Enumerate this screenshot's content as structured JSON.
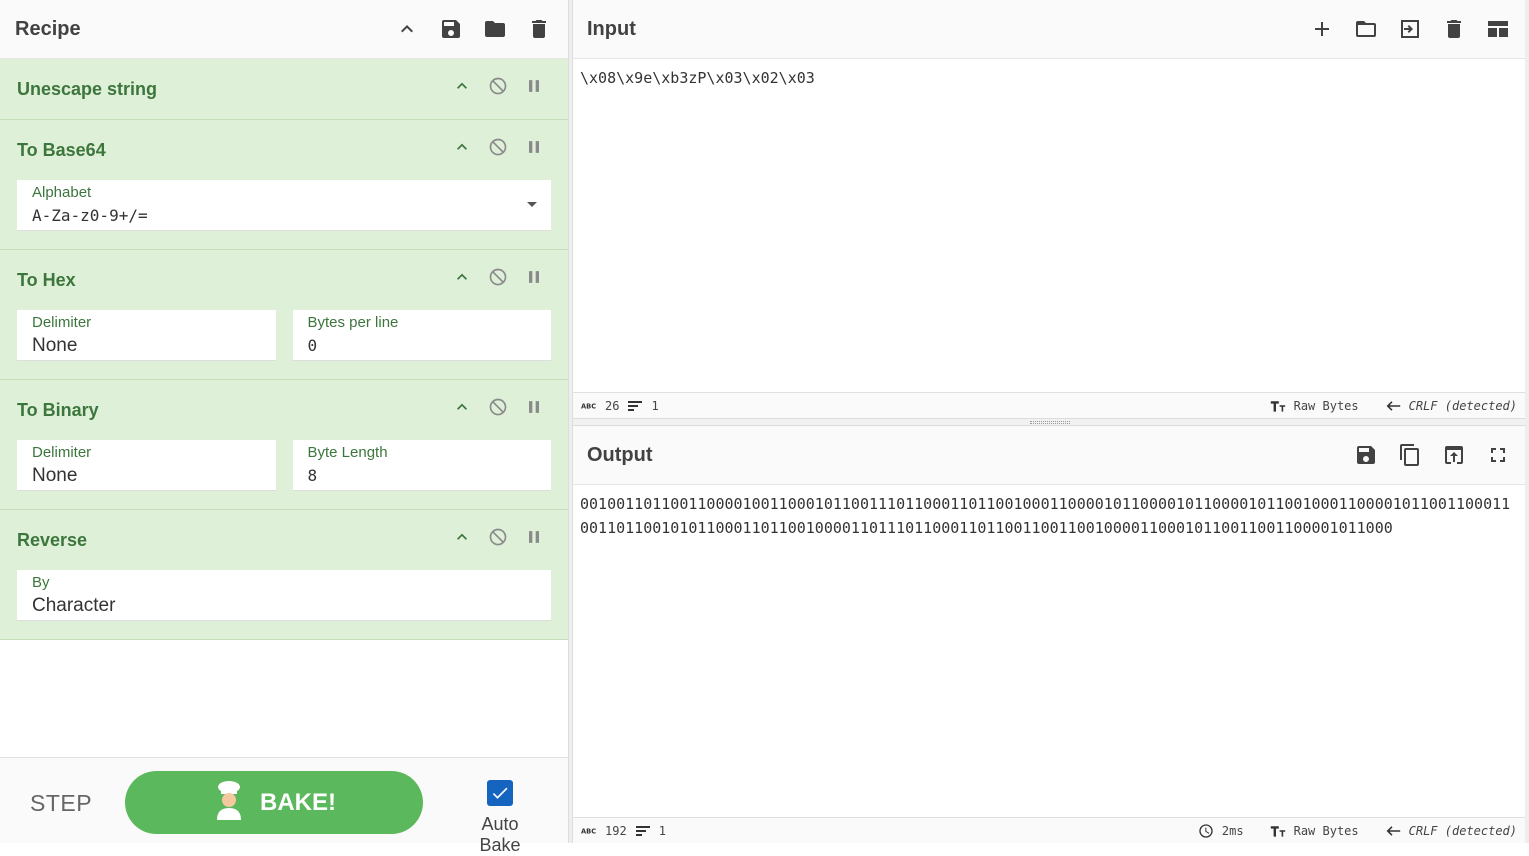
{
  "recipe": {
    "title": "Recipe",
    "operations": [
      {
        "name": "Unescape string",
        "args": []
      },
      {
        "name": "To Base64",
        "args": [
          {
            "label": "Alphabet",
            "value": "A-Za-z0-9+/="
          }
        ]
      },
      {
        "name": "To Hex",
        "args": [
          {
            "label": "Delimiter",
            "value": "None"
          },
          {
            "label": "Bytes per line",
            "value": "0"
          }
        ]
      },
      {
        "name": "To Binary",
        "args": [
          {
            "label": "Delimiter",
            "value": "None"
          },
          {
            "label": "Byte Length",
            "value": "8"
          }
        ]
      },
      {
        "name": "Reverse",
        "args": [
          {
            "label": "By",
            "value": "Character"
          }
        ]
      }
    ],
    "footer": {
      "step_label": "STEP",
      "bake_label": "BAKE!",
      "autobake_label": "Auto Bake",
      "autobake_checked": true
    }
  },
  "input": {
    "title": "Input",
    "text": "\\x08\\x9e\\xb3zP\\x03\\x02\\x03",
    "stats": {
      "chars": "26",
      "lines": "1",
      "encoding": "Raw Bytes",
      "eol": "CRLF (detected)"
    }
  },
  "output": {
    "title": "Output",
    "text": "0010011011001100001001100010110011101100011011001000110000101100001011000010110010001100001011001100011001101100101011000110110010000110111011000110110011001100100001100010110011001100001011000",
    "stats": {
      "chars": "192",
      "lines": "1",
      "time": "2ms",
      "encoding": "Raw Bytes",
      "eol": "CRLF (detected)"
    }
  },
  "colors": {
    "accent_green": "#3c763d",
    "op_bg": "#dff0d8",
    "bake_green": "#5cb85c",
    "checkbox_blue": "#1565c0"
  }
}
